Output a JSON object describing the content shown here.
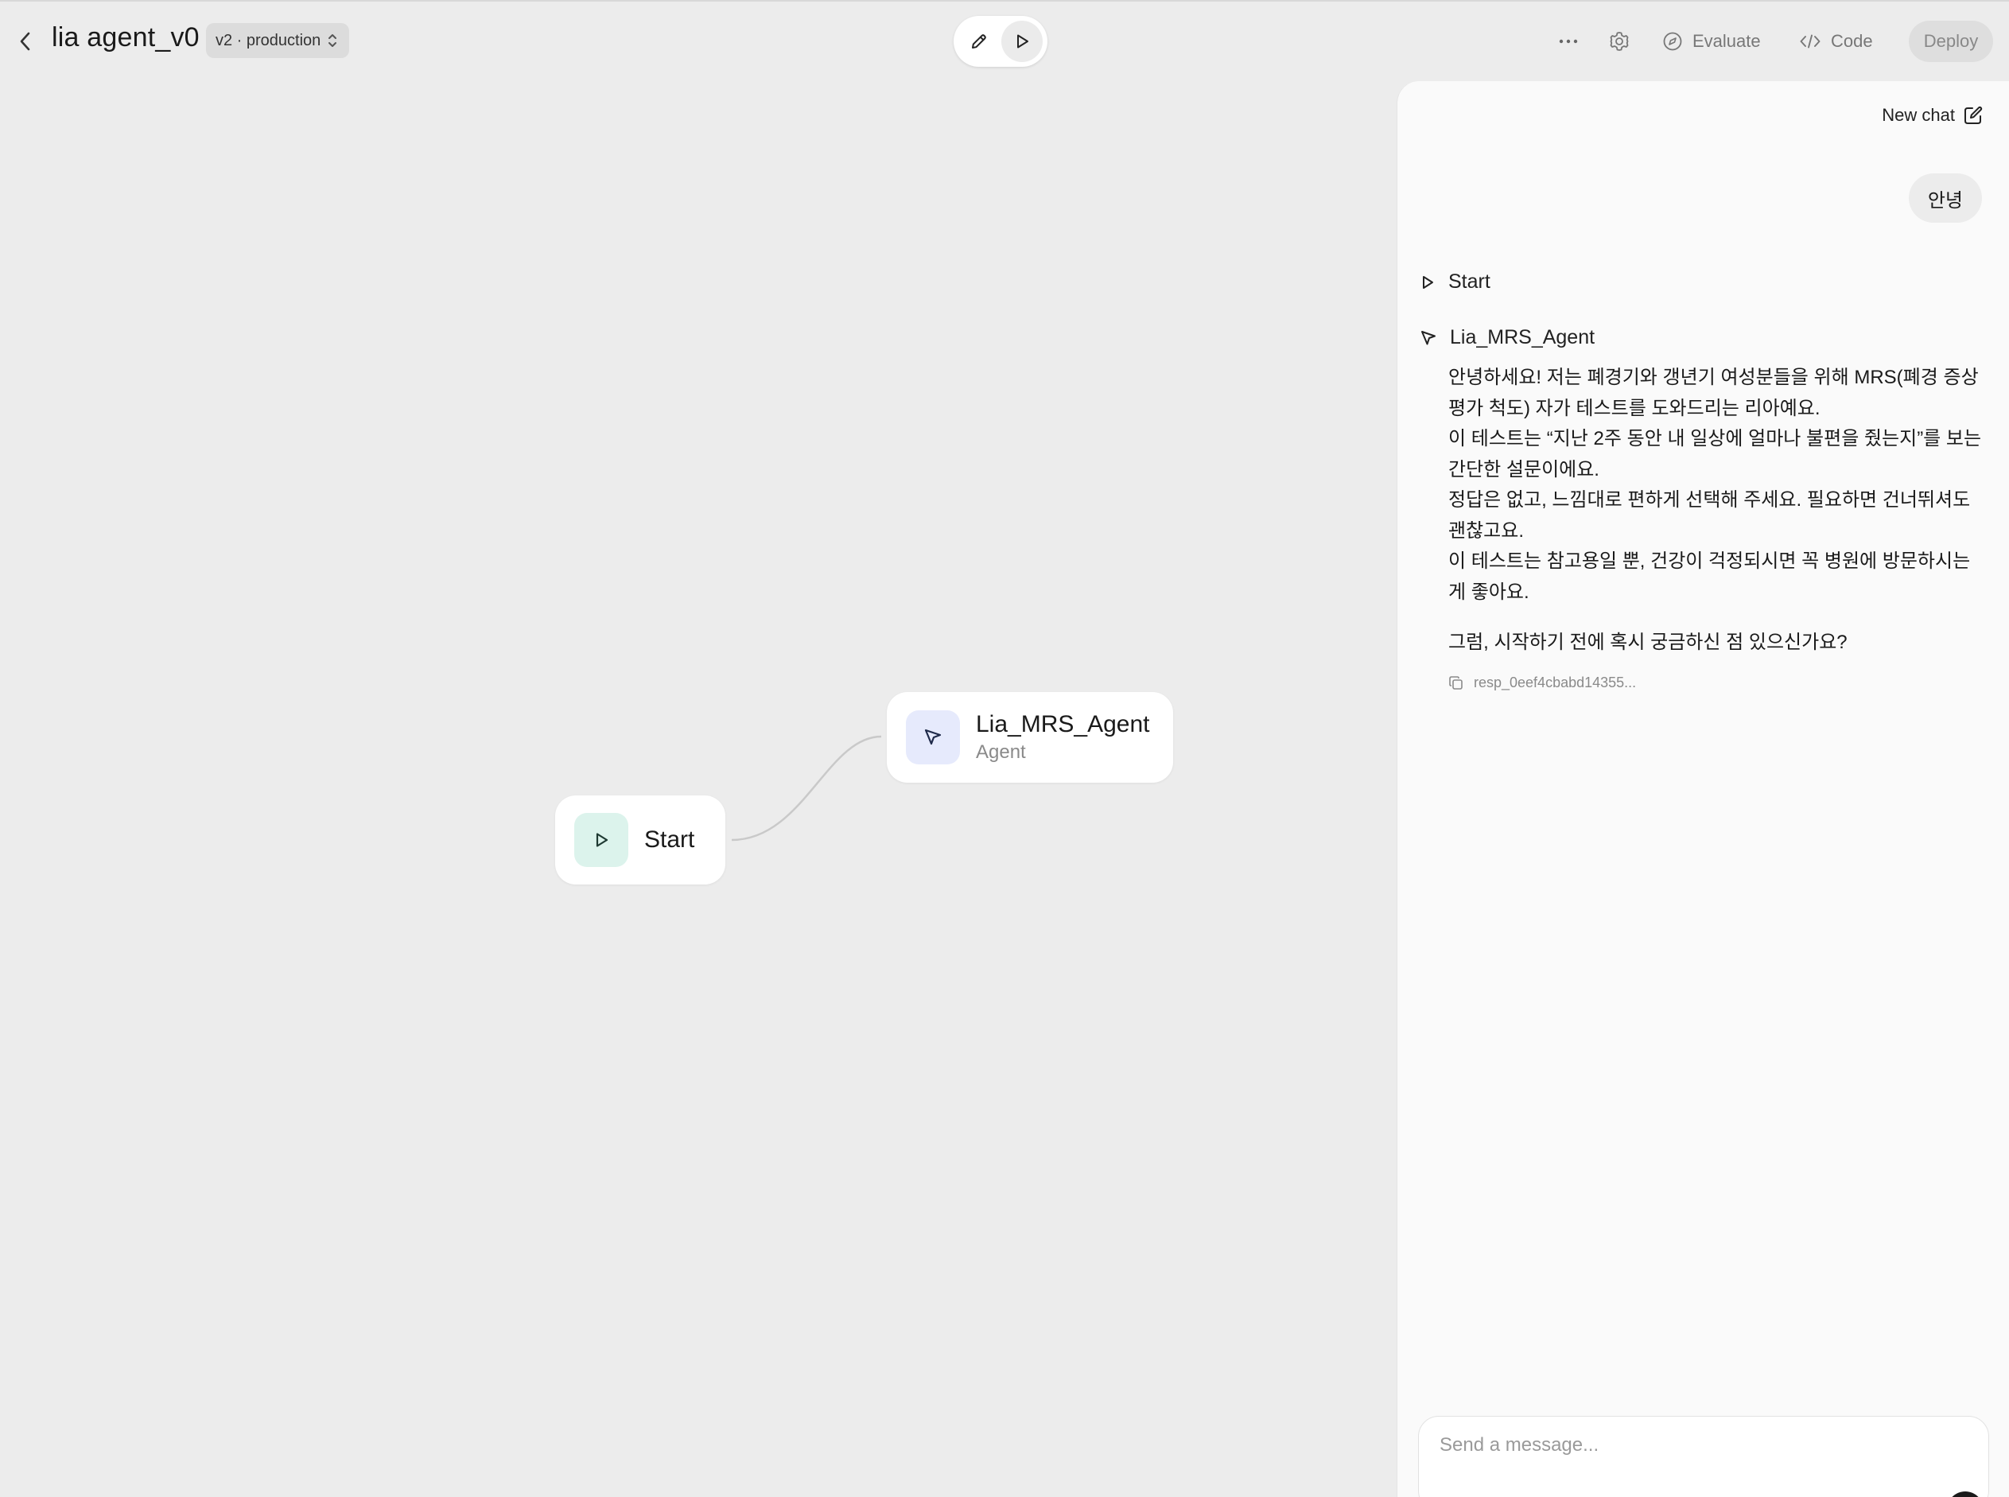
{
  "header": {
    "title": "lia agent_v0",
    "version_label": "v2 · production",
    "evaluate_label": "Evaluate",
    "code_label": "Code",
    "deploy_label": "Deploy"
  },
  "canvas": {
    "nodes": [
      {
        "title": "Start"
      },
      {
        "title": "Lia_MRS_Agent",
        "subtitle": "Agent"
      }
    ]
  },
  "chat": {
    "new_chat_label": "New chat",
    "user_message": "안녕",
    "trace": [
      {
        "label": "Start"
      },
      {
        "label": "Lia_MRS_Agent"
      }
    ],
    "assistant_lines": [
      "안녕하세요! 저는 폐경기와 갱년기 여성분들을 위해 MRS(폐경 증상 평가 척도) 자가 테스트를 도와드리는 리아예요.",
      "이 테스트는 “지난 2주 동안 내 일상에 얼마나 불편을 줬는지”를 보는 간단한 설문이에요.",
      "정답은 없고, 느낌대로 편하게 선택해 주세요. 필요하면 건너뛰셔도 괜찮고요.",
      "이 테스트는 참고용일 뿐, 건강이 걱정되시면 꼭 병원에 방문하시는 게 좋아요."
    ],
    "assistant_closing": "그럼, 시작하기 전에 혹시 궁금하신 점 있으신가요?",
    "response_id": "resp_0eef4cbabd14355...",
    "input_placeholder": "Send a message..."
  },
  "icons": {
    "back": "chevron-left-icon",
    "version_toggle": "chevron-up-down-icon",
    "edit_mode": "pencil-icon",
    "preview_mode": "play-icon",
    "more": "more-horizontal-icon",
    "settings": "gear-icon",
    "evaluate": "evaluate-icon",
    "code": "code-icon",
    "new_chat": "compose-icon",
    "copy": "copy-icon",
    "start_node": "play-icon",
    "agent_node": "cursor-icon"
  },
  "colors": {
    "canvas_background": "#ececec",
    "start_icon_bg": "#dcf3ec",
    "agent_icon_bg": "#e6eafc",
    "deploy_bg": "#dedede"
  }
}
